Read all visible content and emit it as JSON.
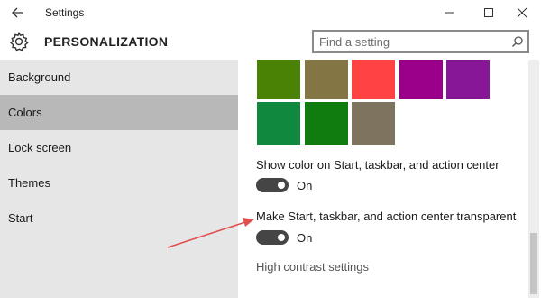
{
  "window": {
    "title": "Settings",
    "back_icon": "back-arrow-icon",
    "controls": [
      "minimize-icon",
      "maximize-icon",
      "close-icon"
    ]
  },
  "header": {
    "icon": "gear-icon",
    "title": "PERSONALIZATION",
    "search_placeholder": "Find a setting",
    "search_icon": "search-icon"
  },
  "sidebar": {
    "items": [
      {
        "label": "Background",
        "selected": false
      },
      {
        "label": "Colors",
        "selected": true
      },
      {
        "label": "Lock screen",
        "selected": false
      },
      {
        "label": "Themes",
        "selected": false
      },
      {
        "label": "Start",
        "selected": false
      }
    ]
  },
  "main": {
    "swatch_colors": [
      "#498205",
      "#847545",
      "#FF4343",
      "#9A0089",
      "#881798",
      "#10893E",
      "#107C10",
      "#7E735F"
    ],
    "settings": [
      {
        "label": "Show color on Start, taskbar, and action center",
        "state": "On",
        "on": true
      },
      {
        "label": "Make Start, taskbar, and action center transparent",
        "state": "On",
        "on": true
      }
    ],
    "link": "High contrast settings"
  },
  "annotation": {
    "arrow_color": "#E05050"
  }
}
